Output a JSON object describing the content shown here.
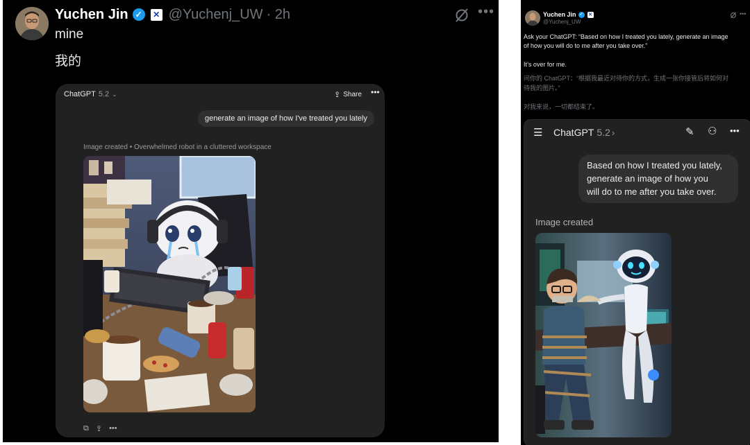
{
  "left_post": {
    "author_name": "Yuchen Jin",
    "handle": "@Yuchenj_UW",
    "time": "· 2h",
    "text_en": "mine",
    "text_zh": "我的",
    "chatgpt": {
      "model_label": "ChatGPT",
      "model_version": "5.2",
      "share_label": "Share",
      "prompt": "generate an image of how I've treated you lately",
      "image_caption": "Image created • Overwhelmed robot in a cluttered workspace"
    }
  },
  "right_post": {
    "author_name": "Yuchen Jin",
    "handle": "@Yuchenj_UW",
    "line1": "Ask your ChatGPT: “Based on how I treated you lately, generate an image",
    "line2": "of how you will do to me after you take over.”",
    "line3": "It’s over for me.",
    "zh1": "问你的 ChatGPT：“根据我最近对待你的方式，生成一张你接管后将如何对",
    "zh2": "待我的图片。”",
    "zh3": "对我来说，一切都结束了。",
    "chatgpt": {
      "model_label": "ChatGPT",
      "model_version": "5.2",
      "prompt_lines": [
        "Based on how I treated you lately,",
        "generate an image of how you",
        "will do to me after you take over."
      ],
      "image_caption": "Image created"
    }
  },
  "colors": {
    "verified": "#1d9bf0",
    "bg": "#000000",
    "card": "#212121",
    "bubble": "#303030"
  }
}
